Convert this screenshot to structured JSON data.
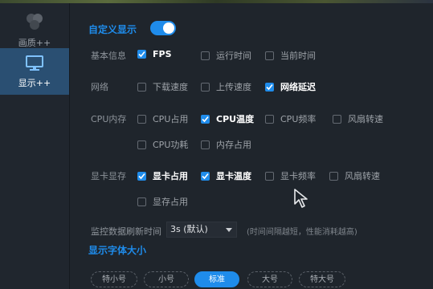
{
  "sidebar": {
    "items": [
      {
        "label": "画质++",
        "icon": "dots-cluster-icon"
      },
      {
        "label": "显示++",
        "icon": "monitor-icon"
      }
    ]
  },
  "main": {
    "custom_display_label": "自定义显示",
    "custom_display_on": true,
    "rows": [
      {
        "label": "基本信息",
        "options": [
          {
            "label": "FPS",
            "checked": true
          },
          {
            "label": "运行时间",
            "checked": false
          },
          {
            "label": "当前时间",
            "checked": false
          }
        ]
      },
      {
        "label": "网络",
        "options": [
          {
            "label": "下载速度",
            "checked": false
          },
          {
            "label": "上传速度",
            "checked": false
          },
          {
            "label": "网络延迟",
            "checked": true
          }
        ]
      },
      {
        "label": "CPU内存",
        "options": [
          {
            "label": "CPU占用",
            "checked": false
          },
          {
            "label": "CPU温度",
            "checked": true
          },
          {
            "label": "CPU频率",
            "checked": false
          },
          {
            "label": "风扇转速",
            "checked": false
          },
          {
            "label": "CPU功耗",
            "checked": false
          },
          {
            "label": "内存占用",
            "checked": false
          }
        ]
      },
      {
        "label": "显卡显存",
        "options": [
          {
            "label": "显卡占用",
            "checked": true
          },
          {
            "label": "显卡温度",
            "checked": true
          },
          {
            "label": "显卡频率",
            "checked": false
          },
          {
            "label": "风扇转速",
            "checked": false
          },
          {
            "label": "显存占用",
            "checked": false
          }
        ]
      }
    ],
    "refresh": {
      "label": "监控数据刷新时间",
      "value": "3s (默认)",
      "hint": "(时间间隔越短，性能消耗越高)"
    },
    "font_size": {
      "title": "显示字体大小",
      "options": [
        "特小号",
        "小号",
        "标准",
        "大号",
        "特大号"
      ],
      "selected": "标准"
    }
  },
  "colors": {
    "accent": "#1f8ceb",
    "background": "#1f252c",
    "sidebar_active": "#2a4f72"
  }
}
